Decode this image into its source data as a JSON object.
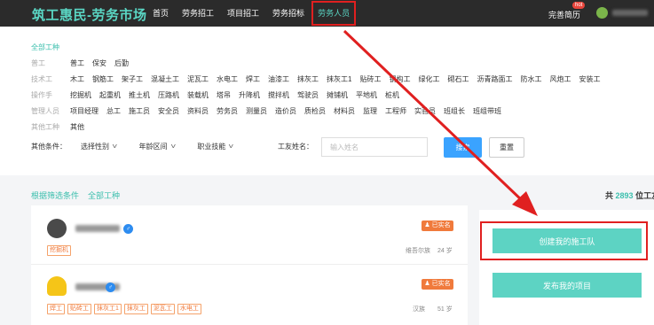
{
  "header": {
    "logo": "筑工惠民-劳务市场",
    "nav": [
      "首页",
      "劳务招工",
      "项目招工",
      "劳务招标",
      "劳务人员"
    ],
    "active_index": 4,
    "resume": "完善简历",
    "hot_badge": "hot"
  },
  "filters": {
    "all_types": "全部工种",
    "categories": [
      {
        "label": "普工",
        "options": [
          "普工",
          "保安",
          "后勤"
        ]
      },
      {
        "label": "技术工",
        "options": [
          "木工",
          "钢筋工",
          "架子工",
          "混凝土工",
          "泥瓦工",
          "水电工",
          "焊工",
          "油漆工",
          "抹灰工",
          "抹灰工1",
          "贴砖工",
          "钢构工",
          "绿化工",
          "砌石工",
          "沥青路面工",
          "防水工",
          "风炮工",
          "安装工"
        ]
      },
      {
        "label": "操作手",
        "options": [
          "挖掘机",
          "起重机",
          "推土机",
          "压路机",
          "装载机",
          "塔吊",
          "升降机",
          "搅拌机",
          "驾驶员",
          "摊铺机",
          "平地机",
          "桩机"
        ]
      },
      {
        "label": "管理人员",
        "options": [
          "项目经理",
          "总工",
          "施工员",
          "安全员",
          "资料员",
          "劳务员",
          "测量员",
          "造价员",
          "质检员",
          "材料员",
          "监理",
          "工程师",
          "实验员",
          "班组长",
          "班组带班"
        ]
      },
      {
        "label": "其他工种",
        "options": [
          "其他"
        ]
      }
    ],
    "other_label": "其他条件：",
    "dropdowns": [
      "选择性别",
      "年龄区间",
      "职业技能"
    ],
    "name_label": "工友姓名：",
    "name_placeholder": "输入姓名",
    "search_btn": "搜索",
    "reset_btn": "重置"
  },
  "results": {
    "filter_label": "根据筛选条件",
    "filter_value": "全部工种",
    "total_prefix": "共",
    "total_count": "2893",
    "total_suffix": "位工友"
  },
  "workers": [
    {
      "verified": "已实名",
      "tags": [
        "挖掘机"
      ],
      "ethnicity": "维吾尔族",
      "age": "24 岁",
      "gender_symbol": "♂",
      "avatar_color": "#4a4a4a"
    },
    {
      "verified": "已实名",
      "tags": [
        "焊工",
        "贴砖工",
        "抹灰工1",
        "抹灰工",
        "泥瓦工",
        "水电工"
      ],
      "ethnicity": "汉族",
      "age": "51 岁",
      "gender_symbol": "♂",
      "avatar_color": "#f5c518"
    }
  ],
  "side": {
    "create_team": "创建我的施工队",
    "publish_project": "发布我的项目"
  },
  "colors": {
    "accent": "#5dd3c3",
    "highlight_red": "#e02020",
    "search_blue": "#3aa3ff",
    "verified_orange": "#f07a3c"
  }
}
